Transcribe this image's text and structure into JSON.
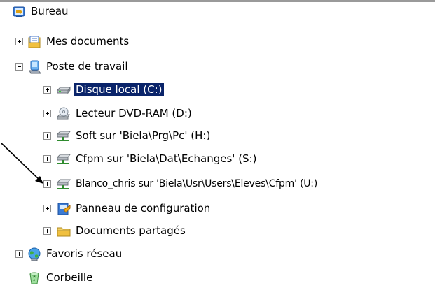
{
  "tree": {
    "desktop": {
      "label": "Bureau",
      "icon": "desktop-icon"
    },
    "my_documents": {
      "label": "Mes documents",
      "icon": "my-documents-icon",
      "expander": "+"
    },
    "my_computer": {
      "label": "Poste de travail",
      "icon": "my-computer-icon",
      "expander": "-"
    },
    "local_disk": {
      "label": "Disque local (C:)",
      "icon": "hard-drive-icon",
      "expander": "+",
      "selected": true
    },
    "dvd_drive": {
      "label": "Lecteur DVD-RAM (D:)",
      "icon": "dvd-drive-icon",
      "expander": "+"
    },
    "network_h": {
      "label": "Soft sur 'Biela\\Prg\\Pc' (H:)",
      "icon": "network-drive-icon",
      "expander": "+"
    },
    "network_s": {
      "label": "Cfpm sur 'Biela\\Dat\\Echanges' (S:)",
      "icon": "network-drive-icon",
      "expander": "+"
    },
    "network_u": {
      "label": "Blanco_chris sur 'Biela\\Usr\\Users\\Eleves\\Cfpm' (U:)",
      "icon": "network-drive-icon",
      "expander": "+"
    },
    "control_panel": {
      "label": "Panneau de configuration",
      "icon": "control-panel-icon",
      "expander": "+"
    },
    "shared_documents": {
      "label": "Documents partagés",
      "icon": "folder-icon",
      "expander": "+"
    },
    "network_places": {
      "label": "Favoris réseau",
      "icon": "network-places-icon",
      "expander": "+"
    },
    "recycle_bin": {
      "label": "Corbeille",
      "icon": "recycle-bin-icon"
    }
  },
  "colors": {
    "selection_bg": "#0a246a",
    "selection_text": "#ffffff",
    "expander_border": "#8f8f8f"
  }
}
